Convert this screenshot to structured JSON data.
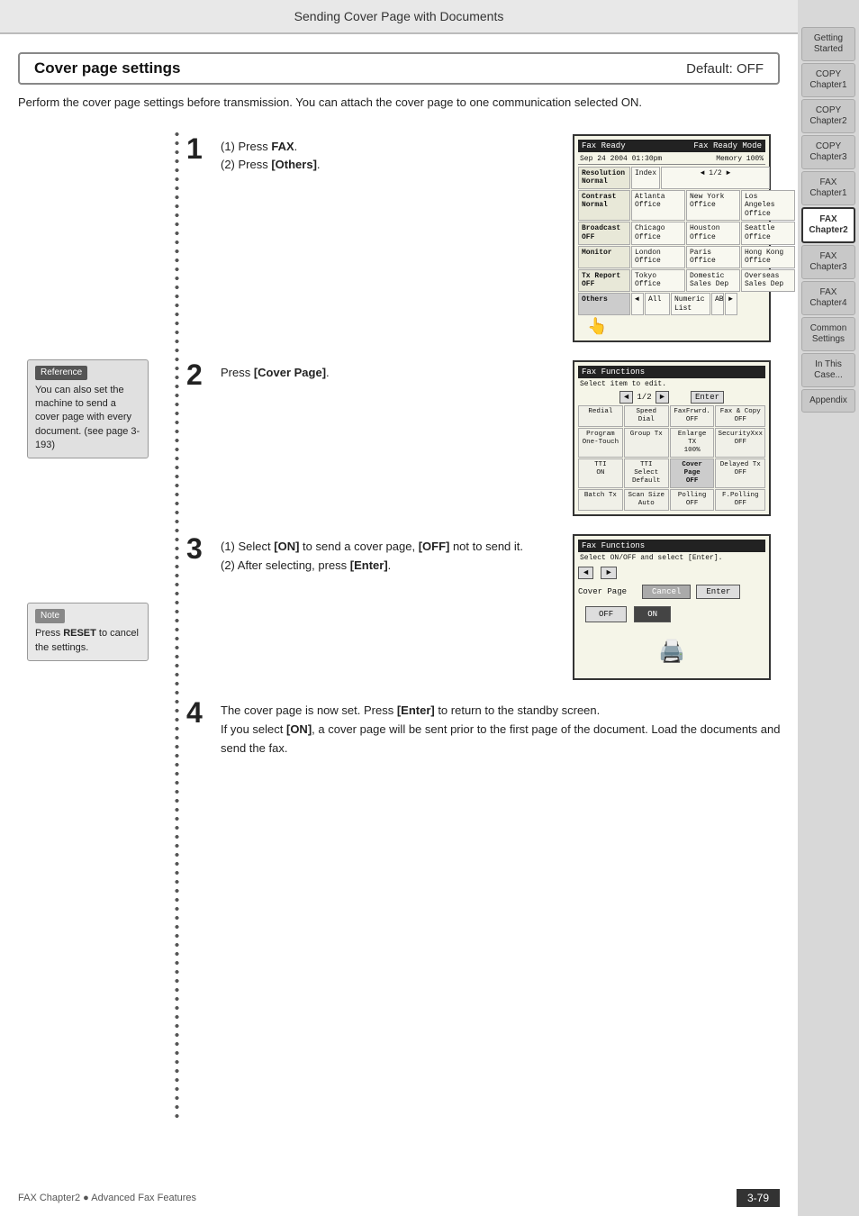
{
  "header": {
    "title": "Sending Cover Page with Documents"
  },
  "section": {
    "title": "Cover page settings",
    "default_label": "Default: OFF"
  },
  "intro": "Perform the cover page settings before transmission. You can attach the cover page to one communication selected ON.",
  "steps": [
    {
      "number": "1",
      "instruction_1": "(1) Press ",
      "instruction_1_bold": "FAX",
      "instruction_2": "(2) Press ",
      "instruction_2_bold": "[Others]",
      "instruction_2_end": "."
    },
    {
      "number": "2",
      "instruction": "Press ",
      "instruction_bold": "[Cover Page]",
      "instruction_end": "."
    },
    {
      "number": "3",
      "instruction_1": "(1) Select ",
      "instruction_1_bold": "[ON]",
      "instruction_1_mid": " to send a cover page, ",
      "instruction_1_bold2": "[OFF]",
      "instruction_1_end": " not to send it.",
      "instruction_2": "(2) After selecting, press ",
      "instruction_2_bold": "[Enter]",
      "instruction_2_end": "."
    },
    {
      "number": "4",
      "instruction_1": "The cover page is now set. Press ",
      "instruction_1_bold": "[Enter]",
      "instruction_1_end": " to return to the standby screen.",
      "instruction_2": "If you select ",
      "instruction_2_bold": "[ON]",
      "instruction_2_end": ", a cover page will be sent prior to the first page of the document. Load the documents and send the fax."
    }
  ],
  "reference": {
    "label": "Reference",
    "text": "You can also set the machine to send a cover page with every document. (see page 3-193)"
  },
  "note": {
    "label": "Note",
    "text": "Press RESET to cancel the settings."
  },
  "fax_ready_screen": {
    "title": "Fax Ready",
    "mode": "Fax Ready Mode",
    "datetime": "Sep 24 2004 01:30pm",
    "memory": "Memory  100%",
    "rows": [
      {
        "label": "Resolution\nNormal",
        "cells": [
          "Index",
          "",
          "◄  1/2  ►"
        ]
      },
      {
        "label": "Contrast\nNormal",
        "cells": [
          "Atlanta\nOffice",
          "New York\nOffice",
          "Los Angeles\nOffice"
        ]
      },
      {
        "label": "Broadcast\nOFF",
        "cells": [
          "Chicago\nOffice",
          "Houston\nOffice",
          "Seattle\nOffice"
        ]
      },
      {
        "label": "Monitor",
        "cells": [
          "London\nOffice",
          "Paris\nOffice",
          "Hong Kong\nOffice"
        ]
      },
      {
        "label": "Tx Report\nOFF",
        "cells": [
          "Tokyo\nOffice",
          "Domestic\nSales Dep",
          "Overseas\nSales Dep"
        ]
      },
      {
        "label": "Others",
        "cells": [
          "◄",
          "All",
          "Numeric\nList",
          "AB",
          "►"
        ]
      }
    ]
  },
  "fax_functions_screen": {
    "title": "Fax Functions",
    "subtitle": "Select item to edit.",
    "nav": "◄  1/2  ►",
    "enter": "Enter",
    "buttons": [
      [
        "Redial",
        "Speed Dial",
        "FaxFrwrd.\nOFF",
        "Fax & Copy\nOFF"
      ],
      [
        "Program\nOne-Touch",
        "Group Tx",
        "Enlarge TX\n100%",
        "SecurityXxx\nOFF"
      ],
      [
        "TTI\nON",
        "TTI Select\nDefault",
        "Cover Page\nOFF",
        "Delayed Tx\nOFF"
      ],
      [
        "Batch Tx",
        "Scan Size\nAuto",
        "Polling\nOFF",
        "F.Polling\nOFF"
      ]
    ]
  },
  "cover_page_screen": {
    "title": "Fax Functions",
    "subtitle": "Select ON/OFF and select [Enter].",
    "label": "Cover Page",
    "off_btn": "OFF",
    "on_btn": "ON",
    "cancel_btn": "Cancel",
    "enter_btn": "Enter"
  },
  "sidebar": {
    "tabs": [
      {
        "label": "Getting\nStarted",
        "active": false
      },
      {
        "label": "COPY\nChapter1",
        "active": false
      },
      {
        "label": "COPY\nChapter2",
        "active": false
      },
      {
        "label": "COPY\nChapter3",
        "active": false
      },
      {
        "label": "FAX\nChapter1",
        "active": false
      },
      {
        "label": "FAX\nChapter2",
        "active": true
      },
      {
        "label": "FAX\nChapter3",
        "active": false
      },
      {
        "label": "FAX\nChapter4",
        "active": false
      },
      {
        "label": "Common\nSettings",
        "active": false
      },
      {
        "label": "In This\nCase...",
        "active": false
      },
      {
        "label": "Appendix",
        "active": false
      }
    ]
  },
  "footer": {
    "left_text": "FAX Chapter2 ● Advanced Fax Features",
    "page_number": "3-79"
  }
}
